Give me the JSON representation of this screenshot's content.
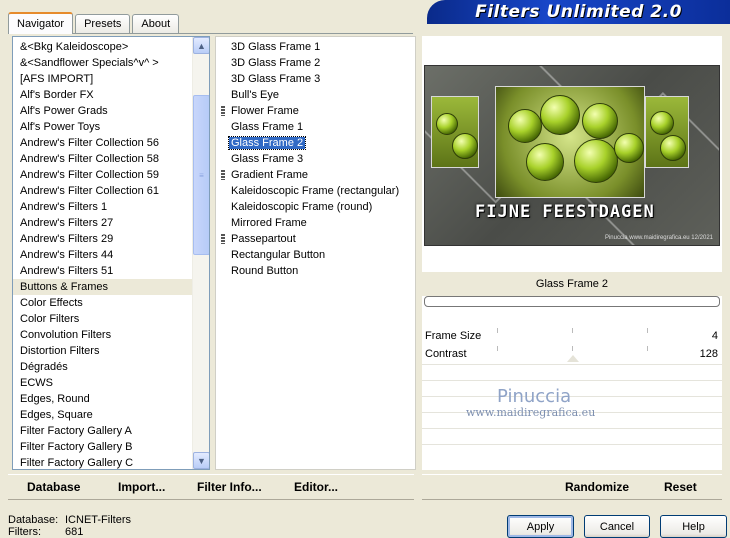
{
  "tabs": [
    {
      "label": "Navigator",
      "active": true
    },
    {
      "label": "Presets",
      "active": false
    },
    {
      "label": "About",
      "active": false
    }
  ],
  "banner": {
    "title": "Filters Unlimited 2.0"
  },
  "categories": {
    "items": [
      "&<Bkg Kaleidoscope>",
      "&<Sandflower Specials^v^ >",
      "[AFS IMPORT]",
      "Alf's Border FX",
      "Alf's Power Grads",
      "Alf's Power Toys",
      "Andrew's Filter Collection 56",
      "Andrew's Filter Collection 58",
      "Andrew's Filter Collection 59",
      "Andrew's Filter Collection 61",
      "Andrew's Filters 1",
      "Andrew's Filters 27",
      "Andrew's Filters 29",
      "Andrew's Filters 44",
      "Andrew's Filters 51",
      "Buttons & Frames",
      "Color Effects",
      "Color Filters",
      "Convolution Filters",
      "Distortion Filters",
      "Dégradés",
      "ECWS",
      "Edges, Round",
      "Edges, Square",
      "Filter Factory Gallery A",
      "Filter Factory Gallery B",
      "Filter Factory Gallery C"
    ],
    "selected_index": 15,
    "scroll_up_icon": "arrow-up-icon",
    "scroll_down_icon": "arrow-down-icon"
  },
  "filters": {
    "items": [
      {
        "label": "3D Glass Frame 1",
        "group": false
      },
      {
        "label": "3D Glass Frame 2",
        "group": false
      },
      {
        "label": "3D Glass Frame 3",
        "group": false
      },
      {
        "label": "Bull's Eye",
        "group": false
      },
      {
        "label": "Flower Frame",
        "group": true
      },
      {
        "label": "Glass Frame 1",
        "group": false
      },
      {
        "label": "Glass Frame 2",
        "group": false
      },
      {
        "label": "Glass Frame 3",
        "group": false
      },
      {
        "label": "Gradient Frame",
        "group": true
      },
      {
        "label": "Kaleidoscopic Frame (rectangular)",
        "group": false
      },
      {
        "label": "Kaleidoscopic Frame (round)",
        "group": false
      },
      {
        "label": "Mirrored Frame",
        "group": false
      },
      {
        "label": "Passepartout",
        "group": true
      },
      {
        "label": "Rectangular Button",
        "group": false
      },
      {
        "label": "Round Button",
        "group": false
      }
    ],
    "selected_index": 6
  },
  "preview": {
    "image_text": "FIJNE FEESTDAGEN",
    "credit": "Pinuccia www.maidiregrafica.eu 12/2021"
  },
  "params": {
    "filter_name": "Glass Frame 2",
    "sliders": [
      {
        "label": "Frame Size",
        "value": "4",
        "level": 4,
        "max": 255
      },
      {
        "label": "Contrast",
        "value": "128",
        "level": 128,
        "max": 255
      }
    ],
    "watermark_name": "Pinuccia",
    "watermark_site": "www.maidiregrafica.eu"
  },
  "toolbar_left": {
    "database": "Database",
    "import": "Import...",
    "filter_info": "Filter Info...",
    "editor": "Editor..."
  },
  "toolbar_right": {
    "randomize": "Randomize",
    "reset": "Reset"
  },
  "status": {
    "database_label": "Database:",
    "database_value": "ICNET-Filters",
    "filters_label": "Filters:",
    "filters_value": "681"
  },
  "dialog_buttons": {
    "apply": "Apply",
    "cancel": "Cancel",
    "help": "Help"
  }
}
